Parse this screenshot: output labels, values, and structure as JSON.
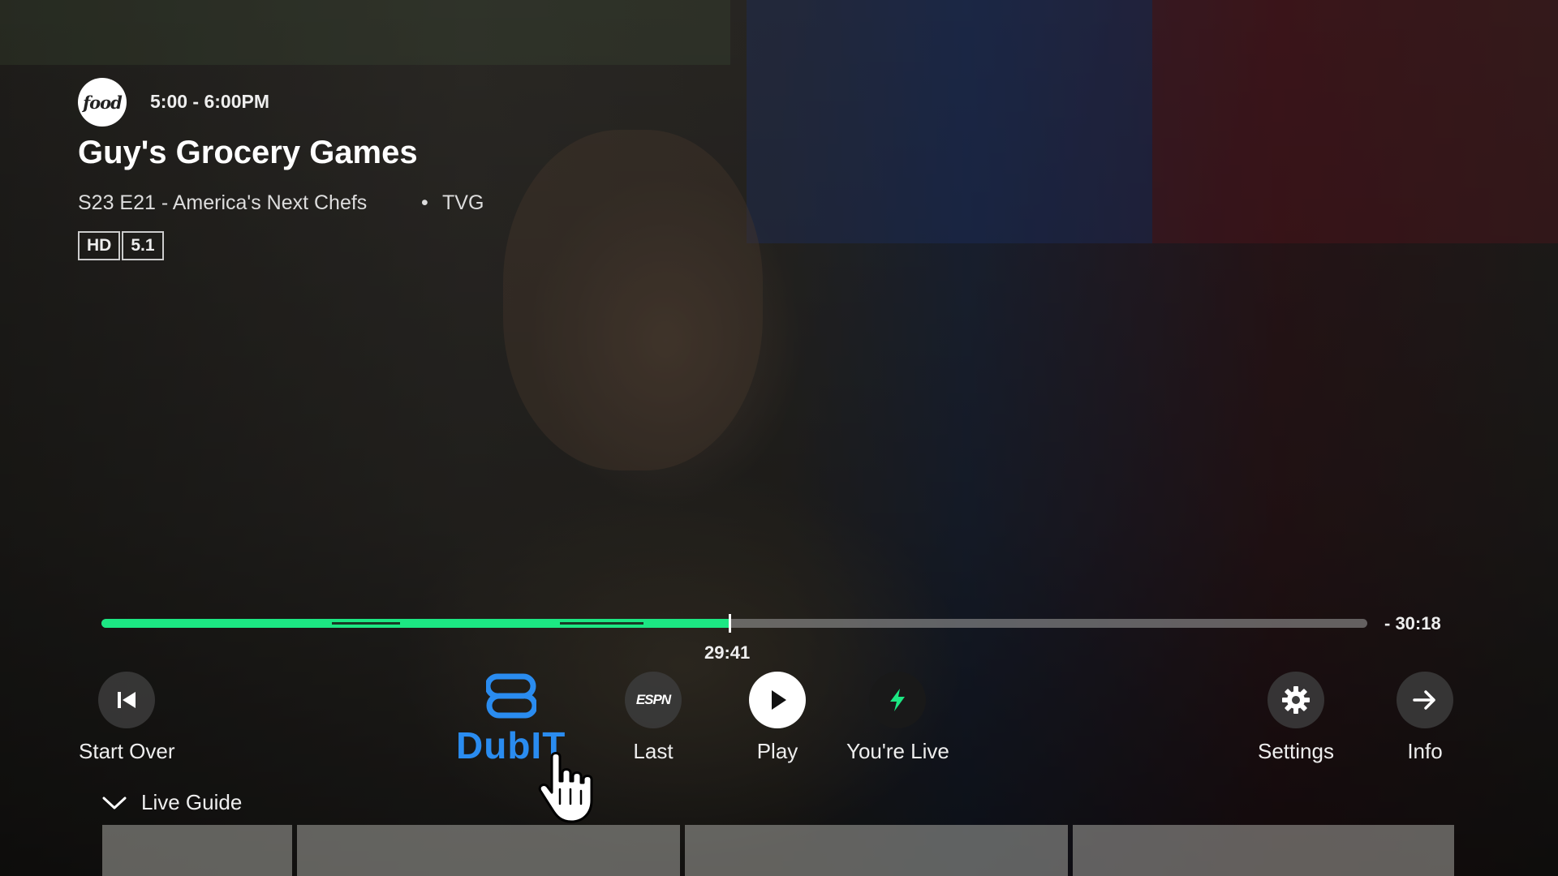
{
  "program": {
    "channel_logo": "food",
    "time": "5:00 - 6:00PM",
    "title": "Guy's Grocery Games",
    "episode": "S23 E21 - America's Next Chefs",
    "separator": "•",
    "rating": "TVG",
    "badges": [
      "HD",
      "5.1"
    ]
  },
  "playback": {
    "current_time": "29:41",
    "remaining_time": "- 30:18",
    "progress_fraction": 0.496
  },
  "controls": {
    "start_over": "Start Over",
    "dubit": "DubIT",
    "last": "Last",
    "last_logo": "ESPN",
    "play": "Play",
    "live": "You're Live",
    "settings": "Settings",
    "info": "Info"
  },
  "guide": {
    "label": "Live Guide"
  },
  "colors": {
    "progress": "#1ce783",
    "dubit": "#2a8cf0",
    "live_icon": "#1ce783"
  }
}
